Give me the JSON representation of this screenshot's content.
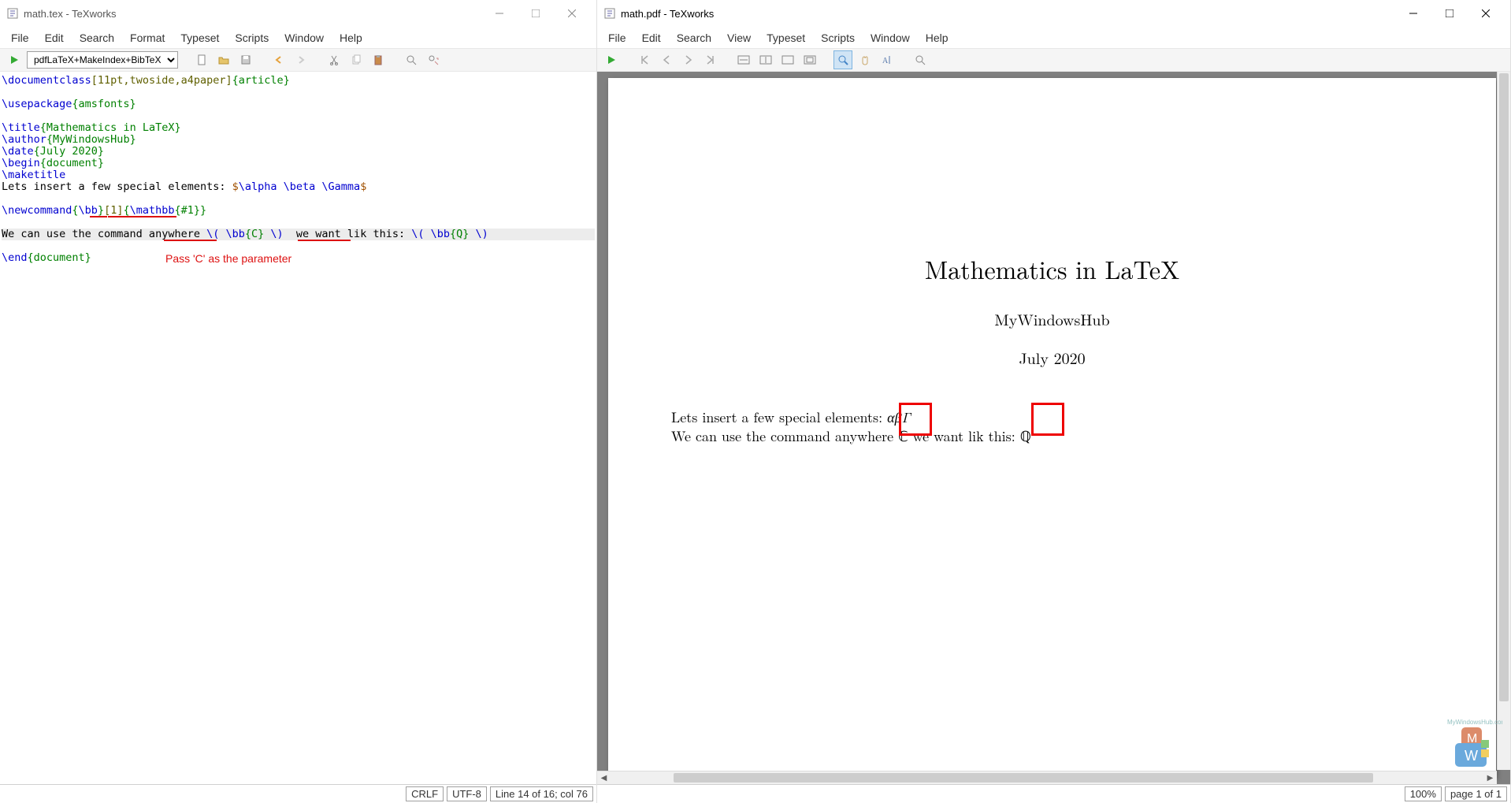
{
  "editor_window": {
    "title": "math.tex - TeXworks",
    "menus": [
      "File",
      "Edit",
      "Search",
      "Format",
      "Typeset",
      "Scripts",
      "Window",
      "Help"
    ],
    "engine_selected": "pdfLaTeX+MakeIndex+BibTeX",
    "status": {
      "eol": "CRLF",
      "encoding": "UTF-8",
      "position": "Line 14 of 16; col 76"
    },
    "code_lines": [
      {
        "tokens": [
          [
            "cmd",
            "\\documentclass"
          ],
          [
            "opt",
            "[11pt,twoside,a4paper]"
          ],
          [
            "brace",
            "{article}"
          ]
        ]
      },
      {
        "tokens": []
      },
      {
        "tokens": [
          [
            "cmd",
            "\\usepackage"
          ],
          [
            "brace",
            "{amsfonts}"
          ]
        ]
      },
      {
        "tokens": []
      },
      {
        "tokens": [
          [
            "cmd",
            "\\title"
          ],
          [
            "brace",
            "{Mathematics in LaTeX}"
          ]
        ]
      },
      {
        "tokens": [
          [
            "cmd",
            "\\author"
          ],
          [
            "brace",
            "{MyWindowsHub}"
          ]
        ]
      },
      {
        "tokens": [
          [
            "cmd",
            "\\date"
          ],
          [
            "brace",
            "{July 2020}"
          ]
        ]
      },
      {
        "tokens": [
          [
            "cmd",
            "\\begin"
          ],
          [
            "brace",
            "{document}"
          ]
        ]
      },
      {
        "tokens": [
          [
            "cmd",
            "\\maketitle"
          ]
        ]
      },
      {
        "tokens": [
          [
            "txt",
            "Lets insert a few special elements: "
          ],
          [
            "math",
            "$"
          ],
          [
            "cmd",
            "\\alpha \\beta \\Gamma"
          ],
          [
            "math",
            "$"
          ]
        ]
      },
      {
        "tokens": []
      },
      {
        "tokens": [
          [
            "cmd",
            "\\newcommand"
          ],
          [
            "brace",
            "{"
          ],
          [
            "cmd",
            "\\bb"
          ],
          [
            "brace",
            "}"
          ],
          [
            "opt",
            "[1]"
          ],
          [
            "brace",
            "{"
          ],
          [
            "cmd",
            "\\mathbb"
          ],
          [
            "brace",
            "{#1}}"
          ]
        ]
      },
      {
        "tokens": []
      },
      {
        "hl": true,
        "tokens": [
          [
            "txt",
            "We can use the command anywhere "
          ],
          [
            "cmd",
            "\\( \\bb"
          ],
          [
            "brace",
            "{C}"
          ],
          [
            "cmd",
            " \\)"
          ],
          [
            "txt",
            "  we want lik this: "
          ],
          [
            "cmd",
            "\\( \\bb"
          ],
          [
            "brace",
            "{Q}"
          ],
          [
            "cmd",
            " \\)"
          ]
        ]
      },
      {
        "tokens": []
      },
      {
        "tokens": [
          [
            "cmd",
            "\\end"
          ],
          [
            "brace",
            "{document}"
          ]
        ]
      }
    ],
    "annotation_label": "Pass 'C' as the parameter"
  },
  "viewer_window": {
    "title": "math.pdf - TeXworks",
    "menus": [
      "File",
      "Edit",
      "Search",
      "View",
      "Typeset",
      "Scripts",
      "Window",
      "Help"
    ],
    "pdf": {
      "doc_title": "Mathematics in LaTeX",
      "author": "MyWindowsHub",
      "date": "July 2020",
      "body_line1_prefix": "Lets insert a few special elements: ",
      "body_line1_math": "αβΓ",
      "body_line2_a": "We can use the command anywhere ",
      "body_line2_C": "ℂ",
      "body_line2_b": " we want lik this: ",
      "body_line2_Q": "ℚ"
    },
    "status": {
      "zoom": "100%",
      "page": "page 1 of 1"
    },
    "watermark": "MyWindowsHub.com"
  }
}
